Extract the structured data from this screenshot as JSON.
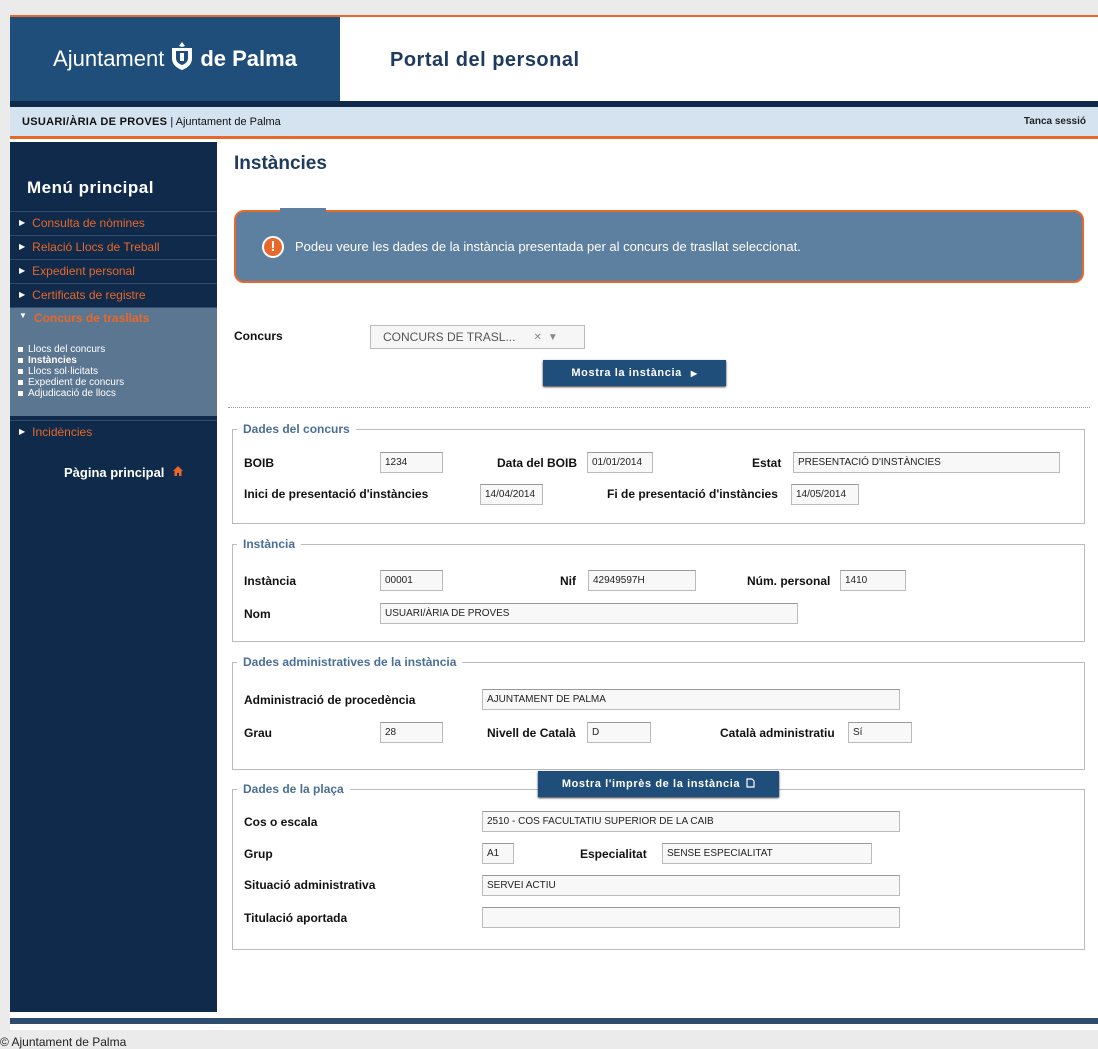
{
  "header": {
    "logo_text_light": "Ajuntament",
    "logo_text_bold": "de Palma",
    "portal_title": "Portal del personal"
  },
  "userbar": {
    "user": "USUARI/ÀRIA DE PROVES",
    "separator": "|",
    "org": "Ajuntament de Palma",
    "logout": "Tanca sessió"
  },
  "sidebar": {
    "title": "Menú principal",
    "items": [
      {
        "label": "Consulta de nòmines"
      },
      {
        "label": "Relació Llocs de Treball"
      },
      {
        "label": "Expedient personal"
      },
      {
        "label": "Certificats de registre"
      },
      {
        "label": "Concurs de trasllats"
      },
      {
        "label": "Incidències"
      }
    ],
    "subitems": [
      {
        "label": "Llocs del concurs"
      },
      {
        "label": "Instàncies"
      },
      {
        "label": "Llocs sol·licitats"
      },
      {
        "label": "Expedient de concurs"
      },
      {
        "label": "Adjudicació de llocs"
      }
    ],
    "home_label": "Pàgina principal"
  },
  "main": {
    "title": "Instàncies",
    "info_message": "Podeu veure les dades de la instància presentada per al concurs de trasllat seleccionat.",
    "concurs_label": "Concurs",
    "concurs_value": "CONCURS DE TRASL...",
    "show_button": "Mostra la instància",
    "print_button": "Mostra l'imprès de la instància",
    "dades_concurs": {
      "legend": "Dades del concurs",
      "boib_label": "BOIB",
      "boib_value": "1234",
      "data_boib_label": "Data del BOIB",
      "data_boib_value": "01/01/2014",
      "estat_label": "Estat",
      "estat_value": "PRESENTACIÓ D'INSTÀNCIES",
      "inici_label": "Inici de presentació d'instàncies",
      "inici_value": "14/04/2014",
      "fi_label": "Fi de presentació d'instàncies",
      "fi_value": "14/05/2014"
    },
    "instancia": {
      "legend": "Instància",
      "instancia_label": "Instància",
      "instancia_value": "00001",
      "nif_label": "Nif",
      "nif_value": "42949597H",
      "num_label": "Núm. personal",
      "num_value": "1410",
      "nom_label": "Nom",
      "nom_value": "USUARI/ÀRIA DE PROVES"
    },
    "dades_admin": {
      "legend": "Dades administratives de la instància",
      "admin_label": "Administració de procedència",
      "admin_value": "AJUNTAMENT DE PALMA",
      "grau_label": "Grau",
      "grau_value": "28",
      "nivell_label": "Nivell de Català",
      "nivell_value": "D",
      "catala_label": "Català administratiu",
      "catala_value": "Sí"
    },
    "dades_placa": {
      "legend": "Dades de la plaça",
      "cos_label": "Cos o escala",
      "cos_value": "2510 - COS FACULTATIU SUPERIOR DE LA CAIB",
      "grup_label": "Grup",
      "grup_value": "A1",
      "esp_label": "Especialitat",
      "esp_value": "SENSE ESPECIALITAT",
      "sit_label": "Situació administrativa",
      "sit_value": "SERVEI ACTIU",
      "tit_label": "Titulació aportada",
      "tit_value": ""
    }
  },
  "footer": {
    "copyright": "© Ajuntament de Palma"
  }
}
